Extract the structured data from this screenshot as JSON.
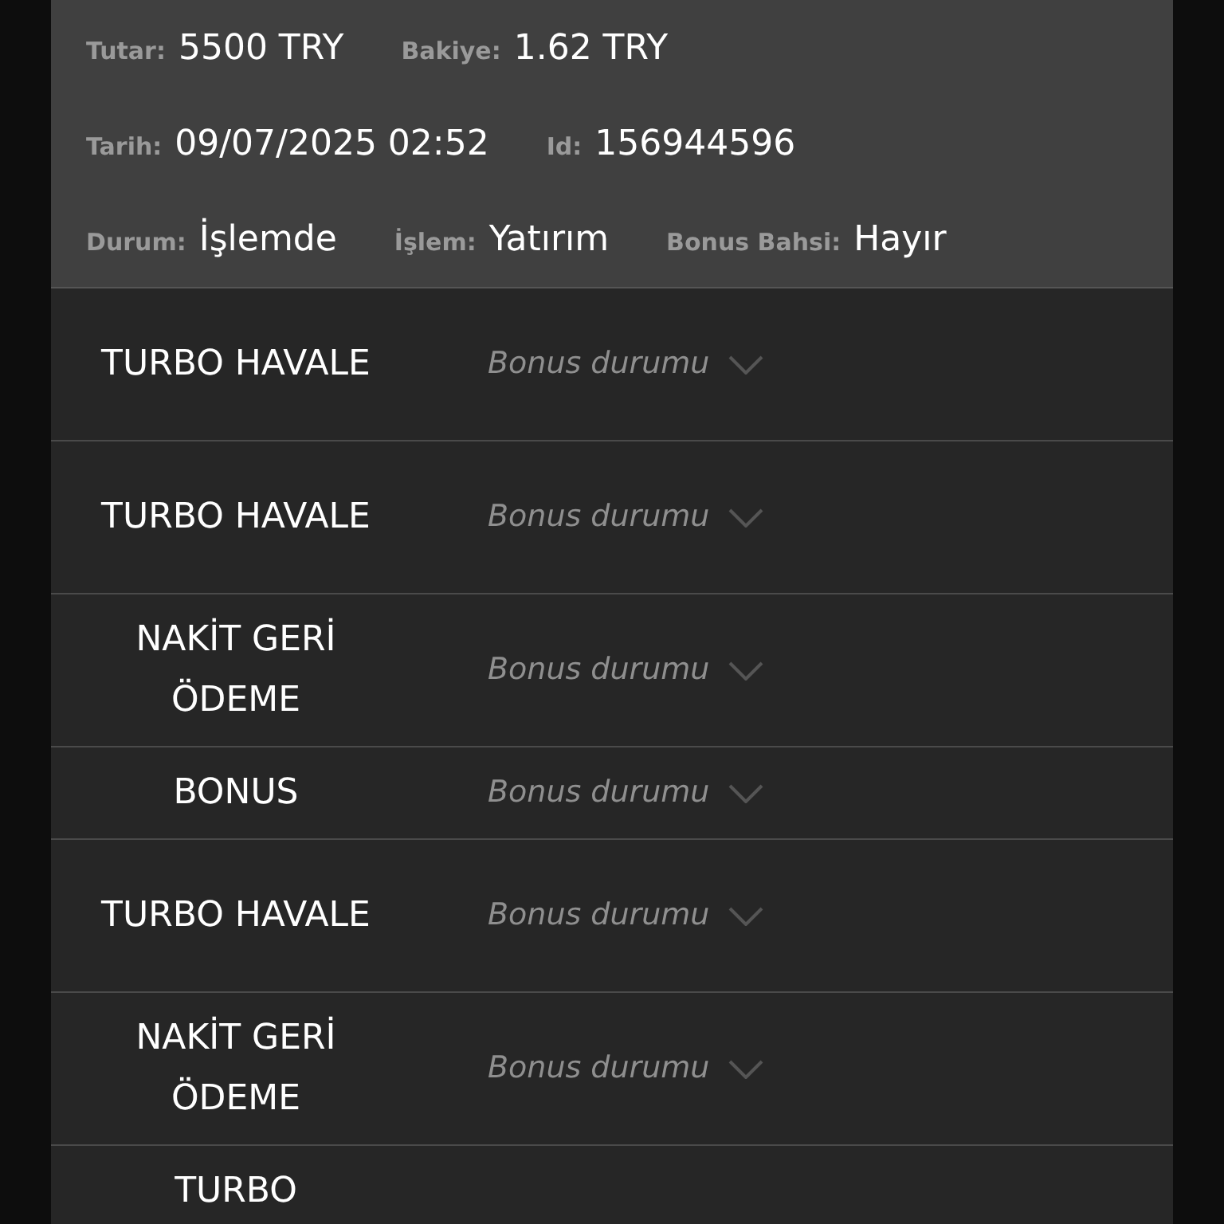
{
  "details": [
    [
      {
        "label": "Tutar:",
        "value": "5500 TRY"
      },
      {
        "label": "Bakiye:",
        "value": "1.62 TRY"
      }
    ],
    [
      {
        "label": "Tarih:",
        "value": "09/07/2025 02:52"
      },
      {
        "label": "Id:",
        "value": "156944596"
      }
    ],
    [
      {
        "label": "Durum:",
        "value": "İşlemde"
      },
      {
        "label": "İşlem:",
        "value": "Yatırım"
      },
      {
        "label": "Bonus Bahsi:",
        "value": "Hayır"
      }
    ]
  ],
  "rows": [
    {
      "name": "TURBO HAVALE",
      "bonus_placeholder": "Bonus durumu"
    },
    {
      "name": "TURBO HAVALE",
      "bonus_placeholder": "Bonus durumu"
    },
    {
      "name": "NAKİT GERİ ÖDEME",
      "bonus_placeholder": "Bonus durumu"
    },
    {
      "name": "BONUS",
      "bonus_placeholder": "Bonus durumu"
    },
    {
      "name": "TURBO HAVALE",
      "bonus_placeholder": "Bonus durumu"
    },
    {
      "name": "NAKİT GERİ ÖDEME",
      "bonus_placeholder": "Bonus durumu"
    },
    {
      "name": "TURBO"
    }
  ]
}
